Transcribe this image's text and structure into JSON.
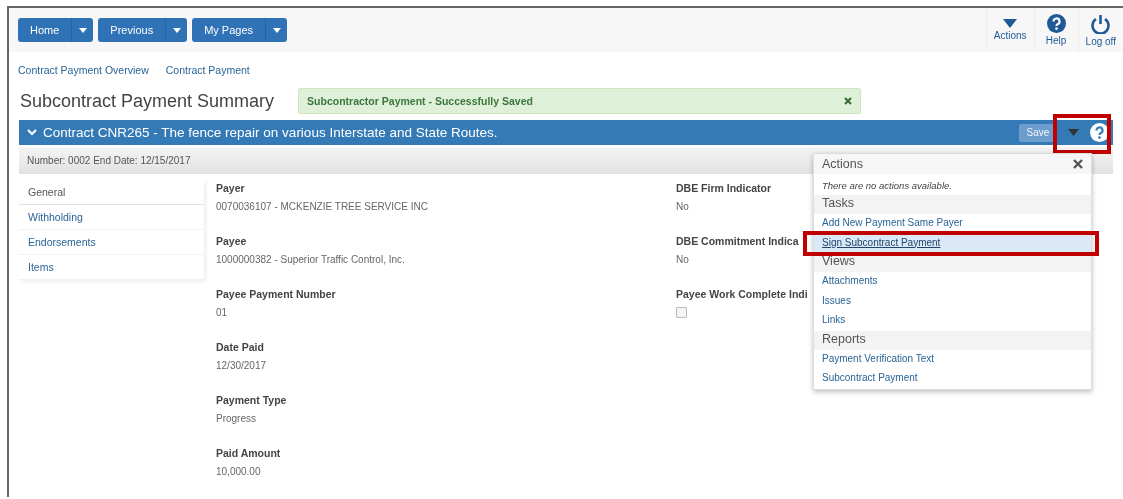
{
  "top_nav": {
    "buttons": [
      {
        "label": "Home"
      },
      {
        "label": "Previous"
      },
      {
        "label": "My Pages"
      }
    ],
    "tools": [
      {
        "label": "Actions",
        "kind": "dropdown"
      },
      {
        "label": "Help",
        "kind": "help"
      },
      {
        "label": "Log off",
        "kind": "logoff"
      }
    ]
  },
  "breadcrumbs": [
    "Contract Payment Overview",
    "Contract Payment"
  ],
  "page_title": "Subcontract Payment Summary",
  "alert": {
    "message": "Subcontractor Payment - Successfully Saved"
  },
  "contract_bar": {
    "title": "Contract CNR265 - The fence repair on various Interstate and State Routes.",
    "expanded": true,
    "save_button": {
      "label": "Save",
      "disabled": true
    },
    "menu_toggle": {
      "highlighted": true
    }
  },
  "summary": "Number: 0002 End Date: 12/15/2017",
  "side_tabs": [
    {
      "label": "General",
      "selected": true
    },
    {
      "label": "Withholding",
      "selected": false
    },
    {
      "label": "Endorsements",
      "selected": false
    },
    {
      "label": "Items",
      "selected": false
    }
  ],
  "fields_left": [
    {
      "kind": "text",
      "label": "Payer",
      "value": "0070036107 - MCKENZIE TREE SERVICE INC"
    },
    {
      "kind": "text",
      "label": "Payee",
      "value": "1000000382 - Superior Traffic Control, Inc."
    },
    {
      "kind": "text",
      "label": "Payee Payment Number",
      "value": "01"
    },
    {
      "kind": "text",
      "label": "Date Paid",
      "value": "12/30/2017"
    },
    {
      "kind": "text",
      "label": "Payment Type",
      "value": "Progress"
    },
    {
      "kind": "text",
      "label": "Paid Amount",
      "value": "10,000.00"
    }
  ],
  "fields_right": [
    {
      "kind": "text",
      "label": "DBE Firm Indicator",
      "value": "No"
    },
    {
      "kind": "text",
      "label": "DBE Commitment Indica",
      "value": "No"
    },
    {
      "kind": "checkbox",
      "label": "Payee Work Complete Indi",
      "checked": false
    }
  ],
  "actions_menu": {
    "title": "Actions",
    "note": "There are no actions available.",
    "sections": [
      {
        "heading": "Tasks",
        "items": [
          {
            "label": "Add New Payment Same Payer",
            "selected": false,
            "highlighted": false
          },
          {
            "label": "Sign Subcontract Payment",
            "selected": true,
            "highlighted": true
          }
        ]
      },
      {
        "heading": "Views",
        "items": [
          {
            "label": "Attachments",
            "selected": false,
            "highlighted": false
          },
          {
            "label": "Issues",
            "selected": false,
            "highlighted": false
          },
          {
            "label": "Links",
            "selected": false,
            "highlighted": false
          }
        ]
      },
      {
        "heading": "Reports",
        "items": [
          {
            "label": "Payment Verification Text",
            "selected": false,
            "highlighted": false
          },
          {
            "label": "Subcontract Payment",
            "selected": false,
            "highlighted": false
          }
        ]
      }
    ]
  }
}
